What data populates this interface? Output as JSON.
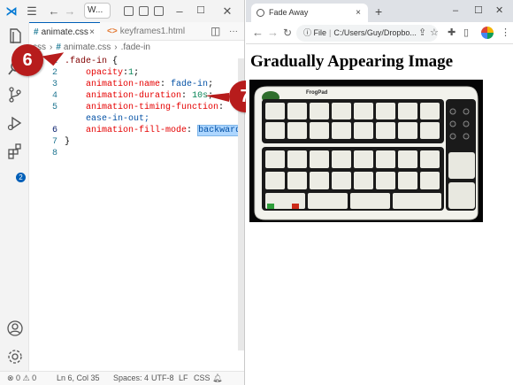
{
  "vscode": {
    "search_text": "W...",
    "tabs": [
      {
        "label": "animate.css",
        "close": "×"
      },
      {
        "label": "keyframes1.html"
      }
    ],
    "breadcrumb": [
      "css",
      "animate.css",
      ".fade-in"
    ],
    "code_lines": [
      {
        "n": "1",
        "selector": ".fade-in",
        "brace": " {"
      },
      {
        "n": "2",
        "prop": "opacity",
        "val": "1"
      },
      {
        "n": "3",
        "prop": "animation-name",
        "val": "fade-in"
      },
      {
        "n": "4",
        "prop": "animation-duration",
        "val": "10s"
      },
      {
        "n": "5",
        "prop": "animation-timing-function",
        "val": ""
      },
      {
        "n": "6",
        "cont": "ease-in-out;"
      },
      {
        "n": "6",
        "prop": "animation-fill-mode",
        "val": "backwards"
      },
      {
        "n": "7",
        "close": "}"
      },
      {
        "n": "8"
      }
    ],
    "status": {
      "errors": "0",
      "warnings": "0",
      "position": "Ln 6, Col 35",
      "spaces": "Spaces: 4",
      "encoding": "UTF-8",
      "eol": "LF",
      "language": "CSS"
    },
    "extensions_badge": "2"
  },
  "callouts": {
    "six": "6",
    "seven": "7"
  },
  "browser": {
    "tab_title": "Fade Away",
    "tab_close": "×",
    "new_tab": "+",
    "omnibox_scheme": "File",
    "omnibox_url": "C:/Users/Guy/Dropbo...",
    "heading": "Gradually Appearing Image",
    "image_alt": "FrogPad keyboard",
    "keyboard_brand": "FrogPad",
    "colors": {
      "tab_strip": "#dee1e6",
      "accent": "#005fb8",
      "callout": "#b71c1c"
    }
  }
}
